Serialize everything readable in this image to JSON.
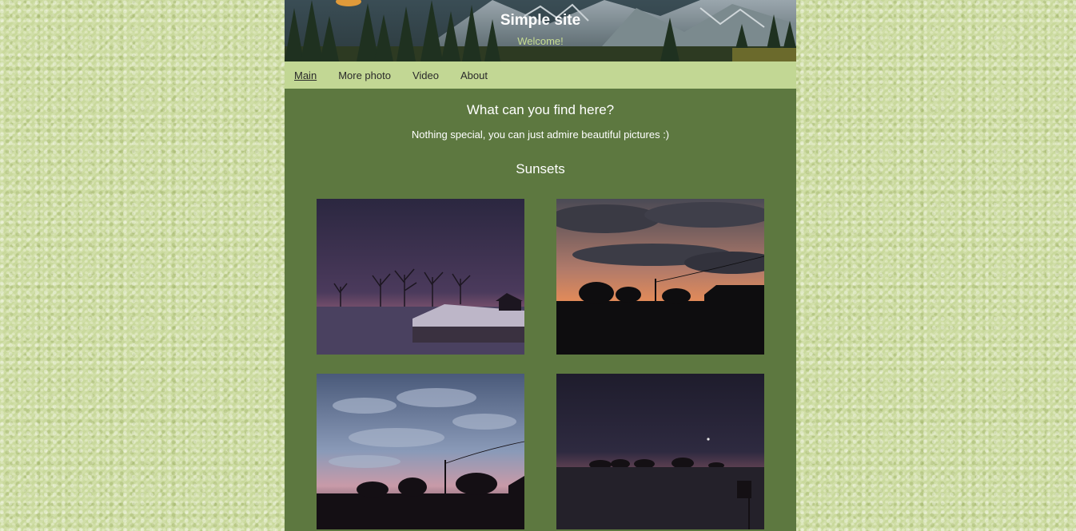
{
  "header": {
    "title": "Simple site",
    "subtitle": "Welcome!"
  },
  "nav": {
    "items": [
      {
        "label": "Main"
      },
      {
        "label": "More photo"
      },
      {
        "label": "Video"
      },
      {
        "label": "About"
      }
    ],
    "active": "Main"
  },
  "main": {
    "heading": "What can you find here?",
    "intro": "Nothing special, you can just admire beautiful pictures :)",
    "section_title": "Sunsets"
  },
  "colors": {
    "page_background": "#c9d99c",
    "content_background": "#5d7840",
    "nav_background": "#c2d794",
    "subtitle_color": "#c6dc92"
  }
}
